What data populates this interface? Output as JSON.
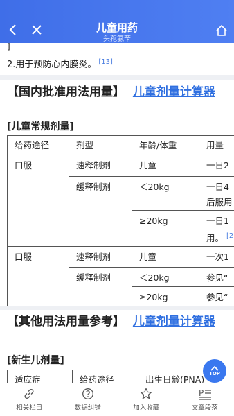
{
  "header": {
    "title": "儿童用药",
    "subtitle": "头孢氨苄"
  },
  "intro": {
    "cont": "]",
    "line": "2.用于预防心内膜炎。",
    "ref": "[13]"
  },
  "domestic": {
    "title": "【国内批准用法用量】",
    "calc": "儿童剂量计算器",
    "sub": "[儿童常规剂量]",
    "headers": [
      "给药途径",
      "剂型",
      "年龄/体重",
      "用量"
    ],
    "rows": {
      "route1": "口服",
      "r1c1": "速释制剂",
      "r1c2": "儿童",
      "r1c3": "一日2",
      "r2c1": "缓释制剂",
      "r2c2": "＜20kg",
      "r2c3a": "一日4",
      "r2c3b": "后服用",
      "r3c2": "≥20kg",
      "r3c3a": "一日1",
      "r3c3b": "用。",
      "r3ref": "[2",
      "route2": "口服",
      "r4c1": "速释制剂",
      "r4c2": "儿童",
      "r4c3": "一次1",
      "r5c1": "缓释制剂",
      "r5c2": "＜20kg",
      "r5c3": "参见“",
      "r6c2": "≥20kg",
      "r6c3": "参见“"
    }
  },
  "other": {
    "title": "【其他用法用量参考】",
    "calc": "儿童剂量计算器",
    "sub": "[新生儿剂量]",
    "headers": [
      "适应症",
      "给药途径",
      "出生日龄(PNA)"
    ]
  },
  "top_button": "TOP",
  "bottom_nav": [
    {
      "label": "相关栏目",
      "icon": "link-icon"
    },
    {
      "label": "数据纠错",
      "icon": "question-icon"
    },
    {
      "label": "加入收藏",
      "icon": "star-icon"
    },
    {
      "label": "文章段落",
      "icon": "paragraph-icon"
    }
  ]
}
